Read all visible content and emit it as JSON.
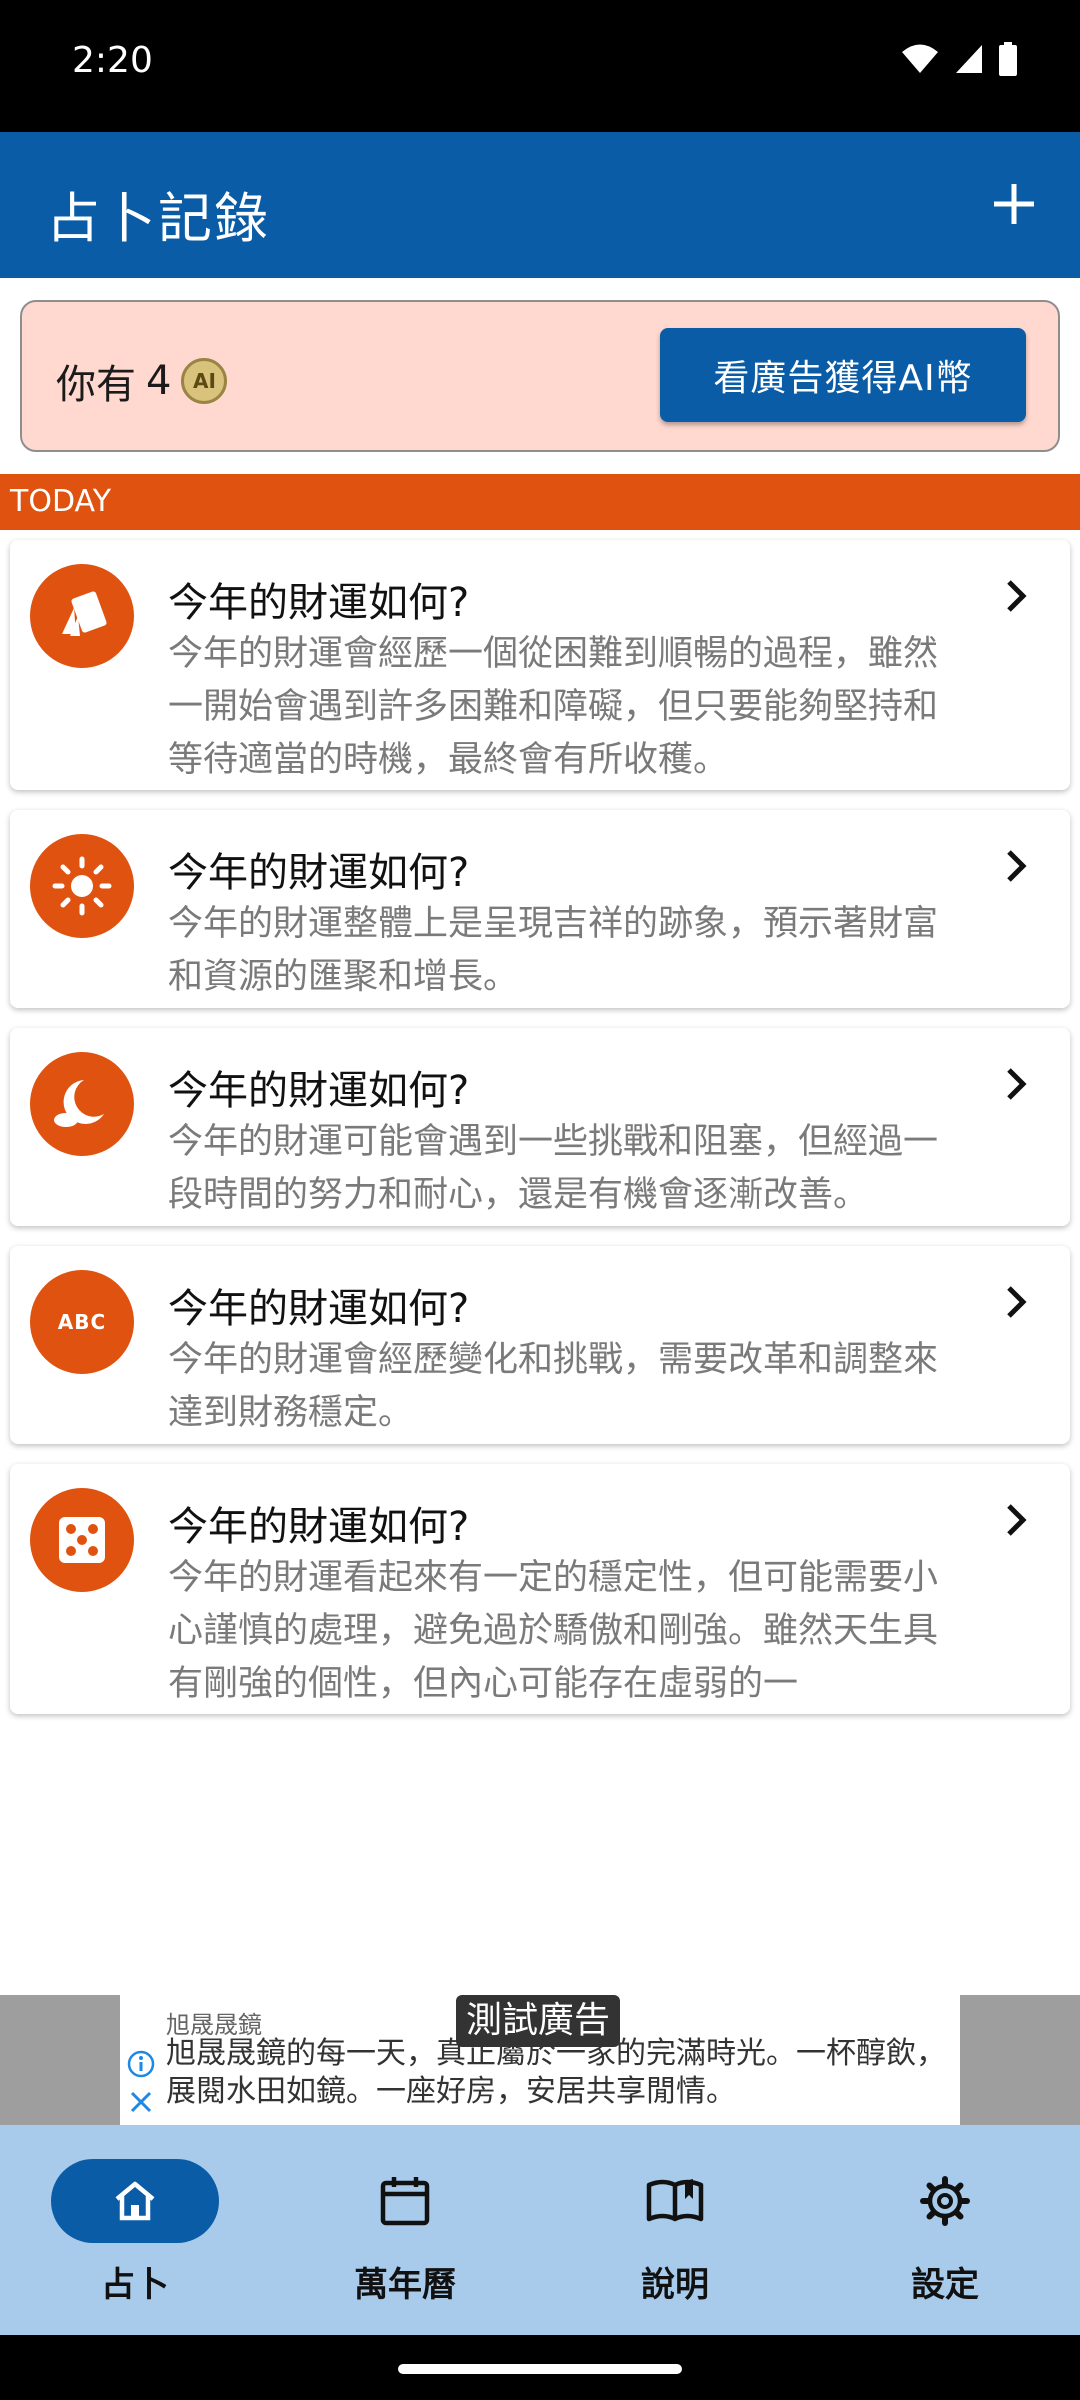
{
  "status_bar": {
    "time": "2:20"
  },
  "app_bar": {
    "title": "占卜記錄",
    "add_icon": "plus-icon"
  },
  "coins": {
    "prefix": "你有",
    "count": "4",
    "coin_icon": "ai-coin-icon",
    "coin_label": "AI",
    "watch_ad_label": "看廣告獲得AI幣"
  },
  "section": {
    "label": "TODAY"
  },
  "records": [
    {
      "title": "今年的財運如何?",
      "body": "今年的財運會經歷一個從困難到順暢的過程，雖然一開始會遇到許多困難和障礙，但只要能夠堅持和等待適當的時機，最終會有所收穫。",
      "icon": "cards-icon"
    },
    {
      "title": "今年的財運如何?",
      "body": "今年的財運整體上是呈現吉祥的跡象，預示著財富和資源的匯聚和增長。",
      "icon": "sun-icon"
    },
    {
      "title": "今年的財運如何?",
      "body": "今年的財運可能會遇到一些挑戰和阻塞，但經過一段時間的努力和耐心，還是有機會逐漸改善。",
      "icon": "moon-icon"
    },
    {
      "title": "今年的財運如何?",
      "body": "今年的財運會經歷變化和挑戰，需要改革和調整來達到財務穩定。",
      "icon": "abc-icon",
      "icon_text": "ABC"
    },
    {
      "title": "今年的財運如何?",
      "body": "今年的財運看起來有一定的穩定性，但可能需要小心謹慎的處理，避免過於驕傲和剛強。雖然天生具有剛強的個性，但內心可能存在虛弱的一",
      "icon": "dice-icon"
    }
  ],
  "ad": {
    "label": "測試廣告",
    "brand": "旭晟晟鏡",
    "text": "旭晟晟鏡的每一天，真正屬於一家的完滿時光。一杯醇飲，展閱水田如鏡。一座好房，安居共享閒情。"
  },
  "bottom_nav": [
    {
      "label": "占卜",
      "icon": "home-icon",
      "active": true
    },
    {
      "label": "萬年曆",
      "icon": "calendar-icon",
      "active": false
    },
    {
      "label": "說明",
      "icon": "book-icon",
      "active": false
    },
    {
      "label": "設定",
      "icon": "gear-icon",
      "active": false
    }
  ],
  "colors": {
    "primary": "#0a5ca6",
    "accent": "#e05210",
    "coin_box_bg": "#ffd9cf",
    "nav_bg": "#a8cbeb"
  }
}
